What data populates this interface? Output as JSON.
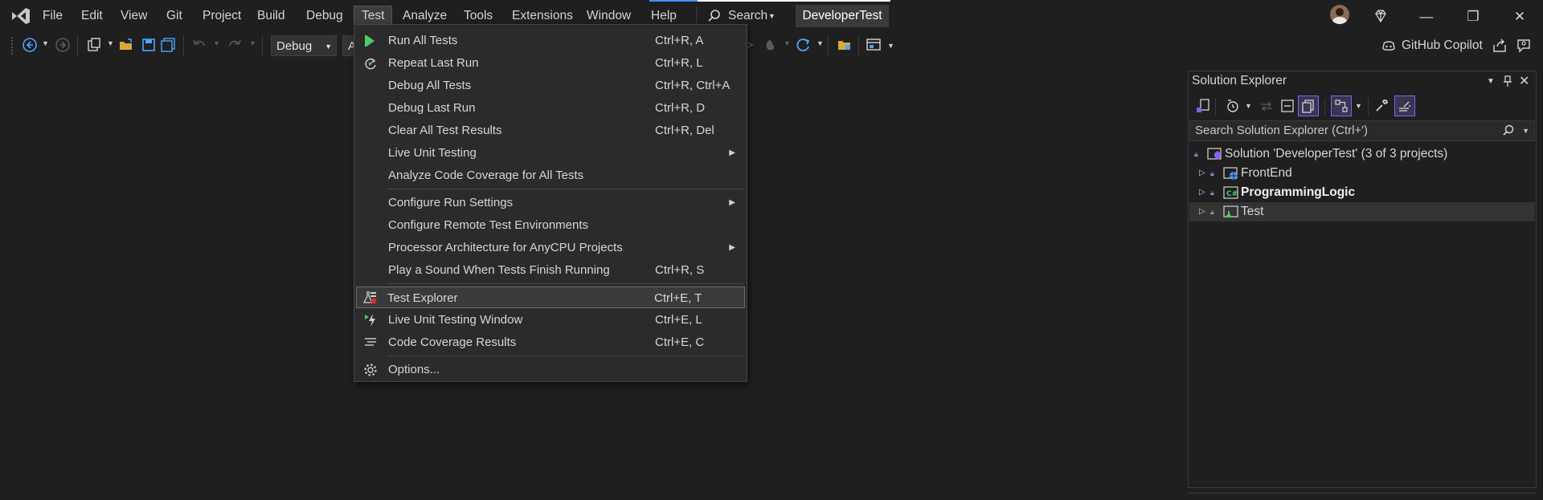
{
  "menubar": {
    "items": [
      "File",
      "Edit",
      "View",
      "Git",
      "Project",
      "Build",
      "Debug",
      "Test",
      "Analyze",
      "Tools",
      "Extensions",
      "Window",
      "Help"
    ],
    "active": "Test",
    "search_label": "Search",
    "project_name": "DeveloperTest"
  },
  "toolbar": {
    "config_combo": "Debug",
    "platform_combo": "A",
    "copilot_label": "GitHub Copilot"
  },
  "test_menu": {
    "items": [
      {
        "label": "Run All Tests",
        "shortcut": "Ctrl+R, A",
        "icon": "run-tests-icon"
      },
      {
        "label": "Repeat Last Run",
        "shortcut": "Ctrl+R, L",
        "icon": "repeat-run-icon"
      },
      {
        "label": "Debug All Tests",
        "shortcut": "Ctrl+R, Ctrl+A"
      },
      {
        "label": "Debug Last Run",
        "shortcut": "Ctrl+R, D"
      },
      {
        "label": "Clear All Test Results",
        "shortcut": "Ctrl+R, Del"
      },
      {
        "label": "Live Unit Testing",
        "submenu": true
      },
      {
        "label": "Analyze Code Coverage for All Tests"
      },
      {
        "label": "Configure Run Settings",
        "submenu": true
      },
      {
        "label": "Configure Remote Test Environments"
      },
      {
        "label": "Processor Architecture for AnyCPU Projects",
        "submenu": true
      },
      {
        "label": "Play a Sound When Tests Finish Running",
        "shortcut": "Ctrl+R, S"
      },
      {
        "label": "Test Explorer",
        "shortcut": "Ctrl+E, T",
        "icon": "test-explorer-icon",
        "highlighted": true
      },
      {
        "label": "Live Unit Testing Window",
        "shortcut": "Ctrl+E, L",
        "icon": "live-unit-testing-icon"
      },
      {
        "label": "Code Coverage Results",
        "shortcut": "Ctrl+E, C",
        "icon": "code-coverage-icon"
      },
      {
        "label": "Options...",
        "icon": "gear-icon"
      }
    ]
  },
  "solution_explorer": {
    "title": "Solution Explorer",
    "search_placeholder": "Search Solution Explorer (Ctrl+')",
    "solution_label": "Solution 'DeveloperTest' (3 of 3 projects)",
    "projects": [
      {
        "name": "FrontEnd",
        "bold": false,
        "selected": false
      },
      {
        "name": "ProgrammingLogic",
        "bold": true,
        "selected": false
      },
      {
        "name": "Test",
        "bold": false,
        "selected": true
      }
    ]
  },
  "colors": {
    "background": "#1f1f1f",
    "menu_bg": "#2b2b2b",
    "accent_purple": "#8b5cf6",
    "run_green": "#4ec96b"
  }
}
